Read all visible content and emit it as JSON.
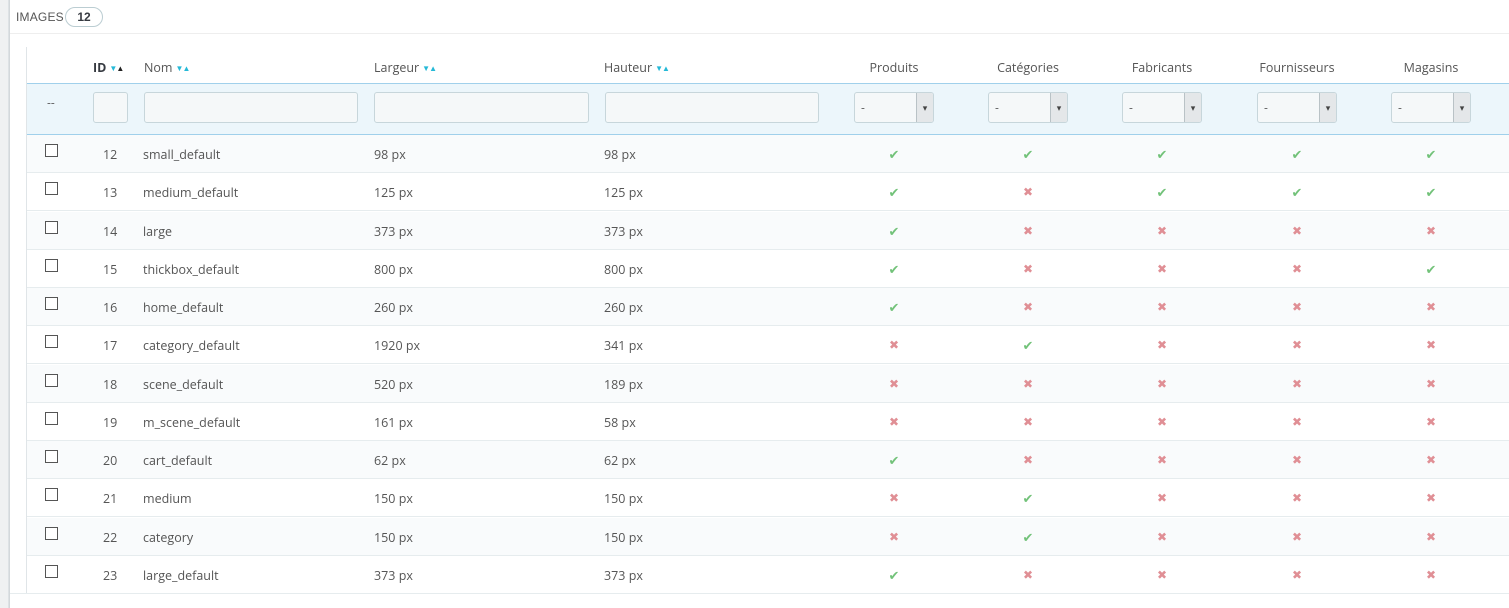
{
  "panel": {
    "title": "IMAGES",
    "count": "12"
  },
  "columns": {
    "id": "ID",
    "name": "Nom",
    "width": "Largeur",
    "height": "Hauteur",
    "products": "Produits",
    "categories": "Catégories",
    "manufacturers": "Fabricants",
    "suppliers": "Fournisseurs",
    "stores": "Magasins"
  },
  "filters": {
    "dash": "--",
    "select_value": "-"
  },
  "icons": {
    "yes": "✔",
    "no": "✖",
    "sort_down": "▼",
    "sort_up": "▲",
    "select_arrow": "▾"
  },
  "colors": {
    "yes": "#72c279",
    "no": "#e08f95",
    "accent": "#25b9d7",
    "filter_bg": "#ecf6fb"
  },
  "rows": [
    {
      "id": "12",
      "name": "small_default",
      "width": "98 px",
      "height": "98 px",
      "products": true,
      "categories": true,
      "manufacturers": true,
      "suppliers": true,
      "stores": true
    },
    {
      "id": "13",
      "name": "medium_default",
      "width": "125 px",
      "height": "125 px",
      "products": true,
      "categories": false,
      "manufacturers": true,
      "suppliers": true,
      "stores": true
    },
    {
      "id": "14",
      "name": "large",
      "width": "373 px",
      "height": "373 px",
      "products": true,
      "categories": false,
      "manufacturers": false,
      "suppliers": false,
      "stores": false
    },
    {
      "id": "15",
      "name": "thickbox_default",
      "width": "800 px",
      "height": "800 px",
      "products": true,
      "categories": false,
      "manufacturers": false,
      "suppliers": false,
      "stores": true
    },
    {
      "id": "16",
      "name": "home_default",
      "width": "260 px",
      "height": "260 px",
      "products": true,
      "categories": false,
      "manufacturers": false,
      "suppliers": false,
      "stores": false
    },
    {
      "id": "17",
      "name": "category_default",
      "width": "1920 px",
      "height": "341 px",
      "products": false,
      "categories": true,
      "manufacturers": false,
      "suppliers": false,
      "stores": false
    },
    {
      "id": "18",
      "name": "scene_default",
      "width": "520 px",
      "height": "189 px",
      "products": false,
      "categories": false,
      "manufacturers": false,
      "suppliers": false,
      "stores": false
    },
    {
      "id": "19",
      "name": "m_scene_default",
      "width": "161 px",
      "height": "58 px",
      "products": false,
      "categories": false,
      "manufacturers": false,
      "suppliers": false,
      "stores": false
    },
    {
      "id": "20",
      "name": "cart_default",
      "width": "62 px",
      "height": "62 px",
      "products": true,
      "categories": false,
      "manufacturers": false,
      "suppliers": false,
      "stores": false
    },
    {
      "id": "21",
      "name": "medium",
      "width": "150 px",
      "height": "150 px",
      "products": false,
      "categories": true,
      "manufacturers": false,
      "suppliers": false,
      "stores": false
    },
    {
      "id": "22",
      "name": "category",
      "width": "150 px",
      "height": "150 px",
      "products": false,
      "categories": true,
      "manufacturers": false,
      "suppliers": false,
      "stores": false
    },
    {
      "id": "23",
      "name": "large_default",
      "width": "373 px",
      "height": "373 px",
      "products": true,
      "categories": false,
      "manufacturers": false,
      "suppliers": false,
      "stores": false
    }
  ]
}
